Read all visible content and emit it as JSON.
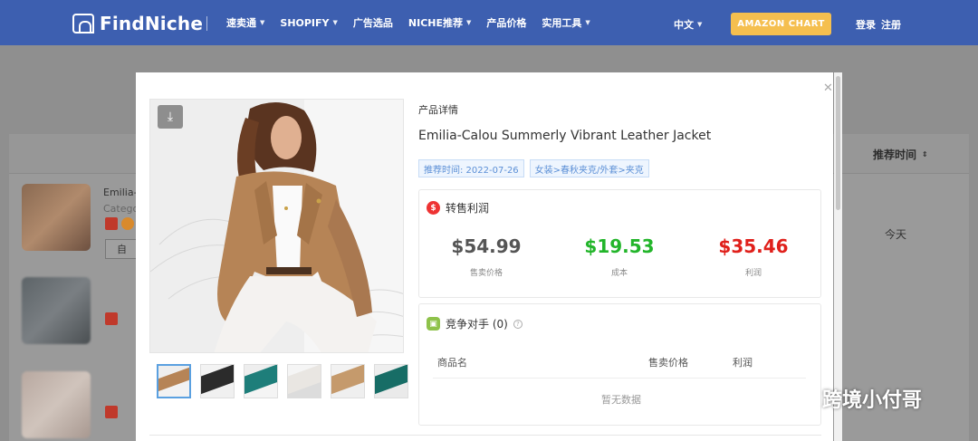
{
  "nav": {
    "logo": "FindNiche",
    "items": [
      {
        "label": "速卖通",
        "caret": true
      },
      {
        "label": "SHOPIFY",
        "caret": true
      },
      {
        "label": "广告选品",
        "caret": false
      },
      {
        "label": "NICHE推荐",
        "caret": true
      },
      {
        "label": "产品价格",
        "caret": false
      },
      {
        "label": "实用工具",
        "caret": true
      }
    ],
    "language": "中文",
    "amazon_button": "AMAZON CHART",
    "login": "登录",
    "register": "注册"
  },
  "background": {
    "sort_label": "推荐时间",
    "first_time": "今天",
    "first_name": "Emilia-C",
    "category_prefix": "Catego",
    "button": "自"
  },
  "modal": {
    "section_label": "产品详情",
    "title": "Emilia-Calou Summerly Vibrant Leather Jacket",
    "tags": [
      "推荐时间: 2022-07-26",
      "女装>春秋夹克/外套>夹克"
    ],
    "profit": {
      "heading": "转售利润",
      "metrics": [
        {
          "value": "$54.99",
          "label": "售卖价格",
          "color": "#555555"
        },
        {
          "value": "$19.53",
          "label": "成本",
          "color": "#22b52a"
        },
        {
          "value": "$35.46",
          "label": "利润",
          "color": "#e0201b"
        }
      ]
    },
    "competitors": {
      "heading": "竞争对手 (0)",
      "columns": [
        "商品名",
        "售卖价格",
        "利润"
      ],
      "empty_text": "暂无数据"
    }
  },
  "watermark": "跨境小付哥",
  "colors": {
    "nav_bg": "#3d5fb0",
    "amazon_btn": "#f5bf4f",
    "tag_text": "#5b8fd6",
    "jacket": "#b68456"
  }
}
